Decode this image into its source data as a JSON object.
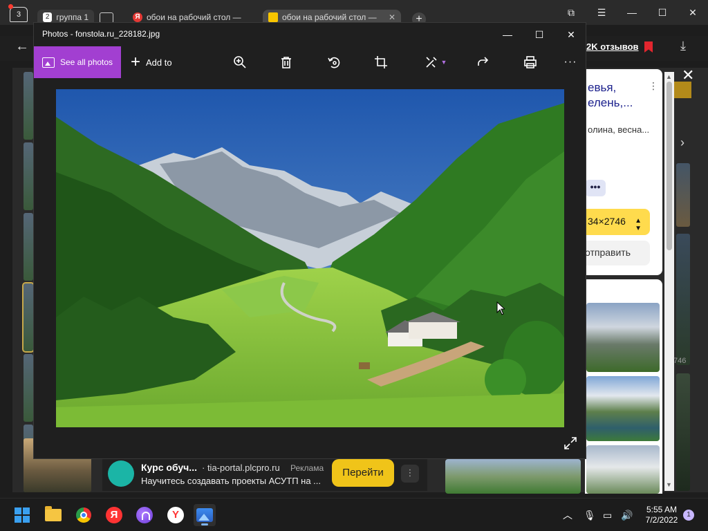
{
  "browser": {
    "tab_count": "3",
    "tabs": [
      {
        "label": "группа 1",
        "group_number": "2"
      },
      {
        "label": "обои на рабочий стол —",
        "favicon": "Я"
      },
      {
        "label": "обои на рабочий стол —",
        "favicon": "image"
      }
    ],
    "reviews_link": "2K отзывов",
    "side_panel": {
      "title": "евья,\nелень,...",
      "subtitle": "олина, весна...",
      "chip": "•••",
      "size": "34×2746",
      "send": "отправить"
    },
    "dim_text": "746",
    "ad": {
      "title": "Курс обуч...",
      "domain": "· tia-portal.plcpro.ru",
      "label": "Реклама",
      "description": "Научитесь создавать проекты АСУТП на ...",
      "go_button": "Перейти",
      "more": "⋮"
    }
  },
  "photos_app": {
    "window_title": "Photos - fonstola.ru_228182.jpg",
    "toolbar": {
      "see_all_photos": "See all photos",
      "add_to": "Add to",
      "more": "···"
    }
  },
  "taskbar": {
    "apps": [
      "start-icon",
      "file-explorer-icon",
      "chrome-icon",
      "yandex-icon",
      "alice-icon",
      "yandex-browser-icon",
      "photos-icon"
    ],
    "time": "5:55 AM",
    "date": "7/2/2022",
    "notification_count": "1"
  },
  "colors": {
    "photos_accent": "#a23fd1",
    "ad_button": "#f0c419",
    "yandex_red": "#ff3333"
  }
}
